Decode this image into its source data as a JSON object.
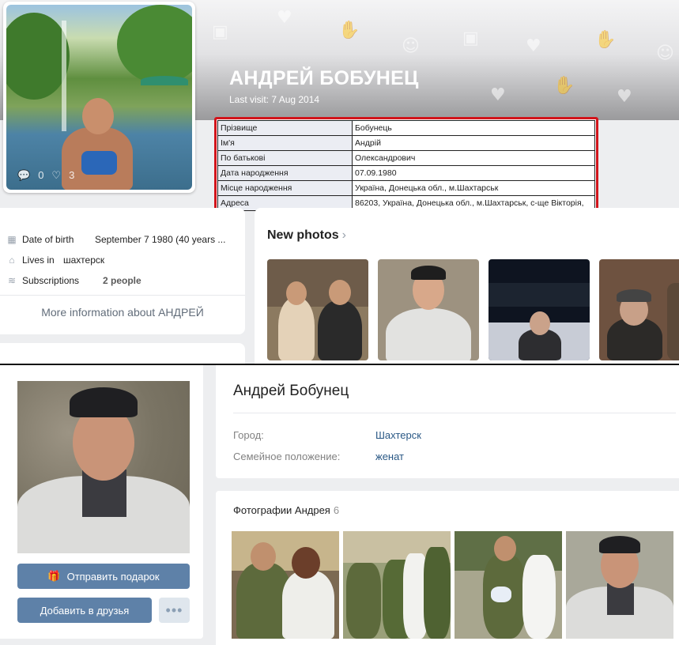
{
  "top": {
    "profile_name": "АНДРЕЙ БОБУНЕЦ",
    "last_visit": "Last visit: 7 Aug 2014",
    "avatar_stats": {
      "comments": "0",
      "likes": "3"
    },
    "info_table": [
      {
        "key": "Прізвище",
        "value": "Бобунець"
      },
      {
        "key": "Ім'я",
        "value": "Андрій"
      },
      {
        "key": "По батькові",
        "value": "Олександрович"
      },
      {
        "key": "Дата народження",
        "value": "07.09.1980"
      },
      {
        "key": "Місце народження",
        "value": "Україна, Донецька обл., м.Шахтарськ"
      },
      {
        "key": "Адреса",
        "value": "86203, Україна, Донецька обл., м.Шахтарськ, с-ще Вікторія,"
      }
    ],
    "details": {
      "birth_label": "Date of birth",
      "birth_value": "September 7 1980 (40 years ...",
      "lives_label": "Lives in",
      "lives_value": "шахтерск",
      "subs_label": "Subscriptions",
      "subs_value": "2 people",
      "more_info": "More information about АНДРЕЙ"
    },
    "photos_title": "New photos",
    "accent_red": "#d2141b"
  },
  "bottom": {
    "name": "Андрей Бобунец",
    "city_label": "Город:",
    "city_value": "Шахтерск",
    "family_label": "Семейное положение:",
    "family_value": "женат",
    "gift_button": "Отправить подарок",
    "add_friend_button": "Добавить в друзья",
    "more_button": "•••",
    "photos_title": "Фотографии Андрея",
    "photos_count": "6",
    "accent_blue": "#5e81a8",
    "link_blue": "#2a5885"
  }
}
